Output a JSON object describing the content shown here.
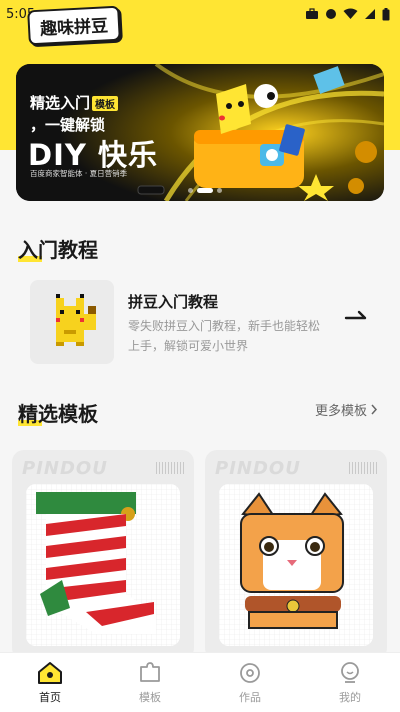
{
  "status_bar": {
    "time": "5:05"
  },
  "app": {
    "title": "趣味拼豆"
  },
  "banner": {
    "line1": "精选入门",
    "tag": "模板",
    "line2": "，一键解锁",
    "big": "DIY 快乐",
    "sub": "百度商家智能体 · 夏日营销季"
  },
  "tutorial_section": {
    "title": "入门教程",
    "item": {
      "title": "拼豆入门教程",
      "desc": "零失败拼豆入门教程，新手也能轻松上手，解锁可爱小世界"
    }
  },
  "templates_section": {
    "title": "精选模板",
    "more": "更多模板",
    "cards": [
      {
        "brand": "PINDOU"
      },
      {
        "brand": "PINDOU"
      }
    ]
  },
  "tabbar": {
    "items": [
      {
        "label": "首页",
        "icon": "home-icon",
        "active": true
      },
      {
        "label": "模板",
        "icon": "puzzle-icon",
        "active": false
      },
      {
        "label": "作品",
        "icon": "works-icon",
        "active": false
      },
      {
        "label": "我的",
        "icon": "profile-icon",
        "active": false
      }
    ]
  },
  "colors": {
    "accent": "#ffe533",
    "text": "#1a1a1a",
    "muted": "#999999"
  }
}
